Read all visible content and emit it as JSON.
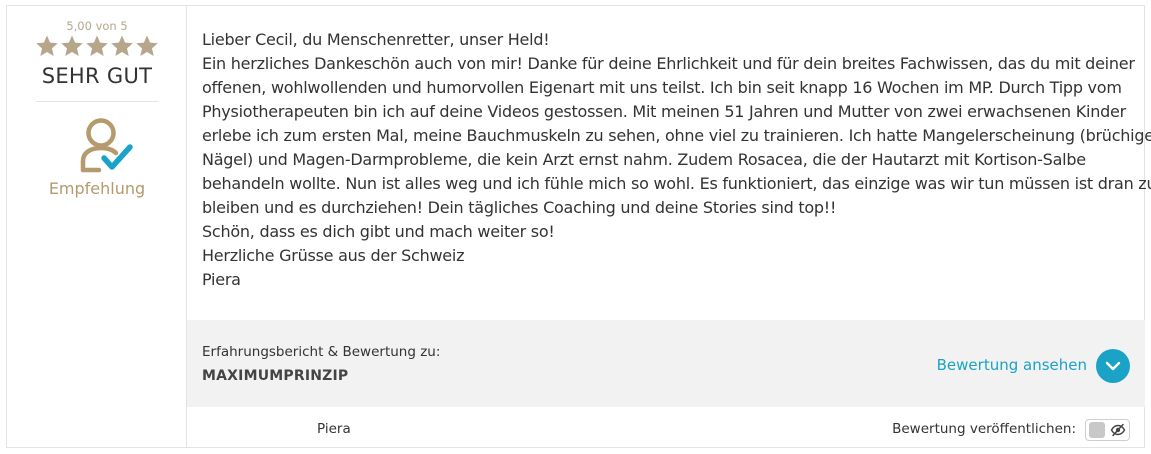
{
  "rating": {
    "score_text": "5,00 von 5",
    "stars": 5,
    "label": "SEHR GUT",
    "star_color": "#b5a68c"
  },
  "recommendation": {
    "icon": "user-check-icon",
    "label": "Empfehlung",
    "colors": {
      "person": "#b49a6c",
      "check": "#1aa3c6"
    }
  },
  "review": {
    "lines": [
      "Lieber Cecil, du Menschenretter, unser Held!",
      "Ein herzliches Dankeschön auch von mir! Danke für deine Ehrlichkeit und für dein breites Fachwissen, das du mit deiner",
      "offenen, wohlwollenden und humorvollen Eigenart mit uns teilst. Ich bin seit knapp 16 Wochen im MP. Durch Tipp vom",
      "Physiotherapeuten bin ich auf deine Videos gestossen. Mit meinen 51 Jahren und Mutter von zwei erwachsenen Kinder",
      "erlebe ich zum ersten Mal, meine Bauchmuskeln zu sehen, ohne viel zu trainieren. Ich hatte Mangelerscheinung (brüchige",
      "Nägel) und Magen-Darmprobleme, die kein Arzt ernst nahm. Zudem Rosacea, die der Hautarzt mit Kortison-Salbe",
      "behandeln wollte. Nun ist alles weg und ich fühle mich so wohl. Es funktioniert, das einzige was wir tun müssen ist dran zu",
      "bleiben und es durchziehen! Dein tägliches Coaching und deine Stories sind top!!",
      "Schön, dass es dich gibt und mach weiter so!",
      "Herzliche Grüsse aus der Schweiz",
      "Piera"
    ]
  },
  "product_box": {
    "label": "Erfahrungsbericht & Bewertung zu:",
    "product": "MAXIMUMPRINZIP",
    "view_link": "Bewertung ansehen",
    "view_icon": "chevron-down-icon",
    "accent": "#1aa3c6",
    "background": "#f2f2f2"
  },
  "footer": {
    "author": "Piera",
    "publish_label": "Bewertung veröffentlichen:",
    "toggle_state": "off",
    "toggle_icon": "eye-slash-icon"
  }
}
